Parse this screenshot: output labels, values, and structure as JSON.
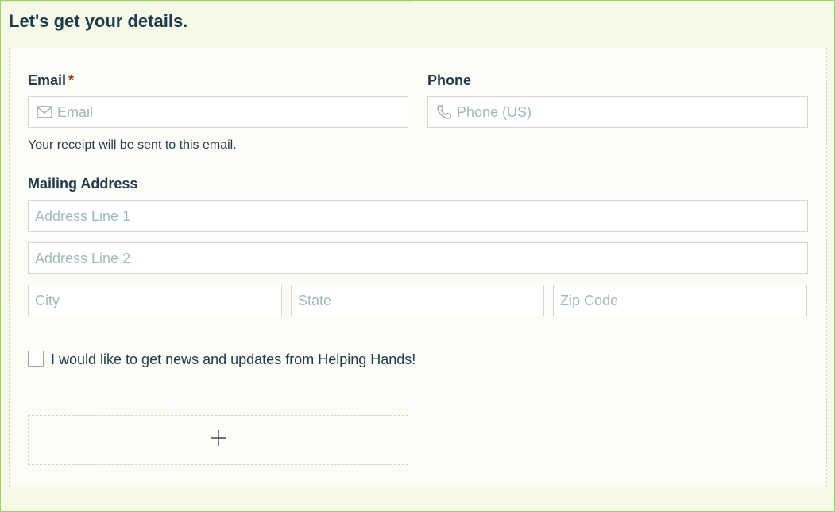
{
  "form": {
    "title": "Let's get your details.",
    "email": {
      "label": "Email",
      "required_mark": "*",
      "placeholder": "Email",
      "help": "Your receipt will be sent to this email.",
      "icon": "envelope-icon"
    },
    "phone": {
      "label": "Phone",
      "placeholder": "Phone (US)",
      "icon": "phone-icon"
    },
    "address": {
      "label": "Mailing Address",
      "line1_placeholder": "Address Line 1",
      "line2_placeholder": "Address Line 2",
      "city_placeholder": "City",
      "state_placeholder": "State",
      "zip_placeholder": "Zip Code"
    },
    "newsletter": {
      "label": "I would like to get news and updates from Helping Hands!",
      "checked": false
    },
    "add_button": {
      "icon": "plus-icon"
    }
  },
  "colors": {
    "background": "#f4f9e8",
    "border_accent": "#9fcf6a",
    "text": "#1f3a4a",
    "placeholder": "#9fbabb",
    "required": "#a23a2a"
  }
}
